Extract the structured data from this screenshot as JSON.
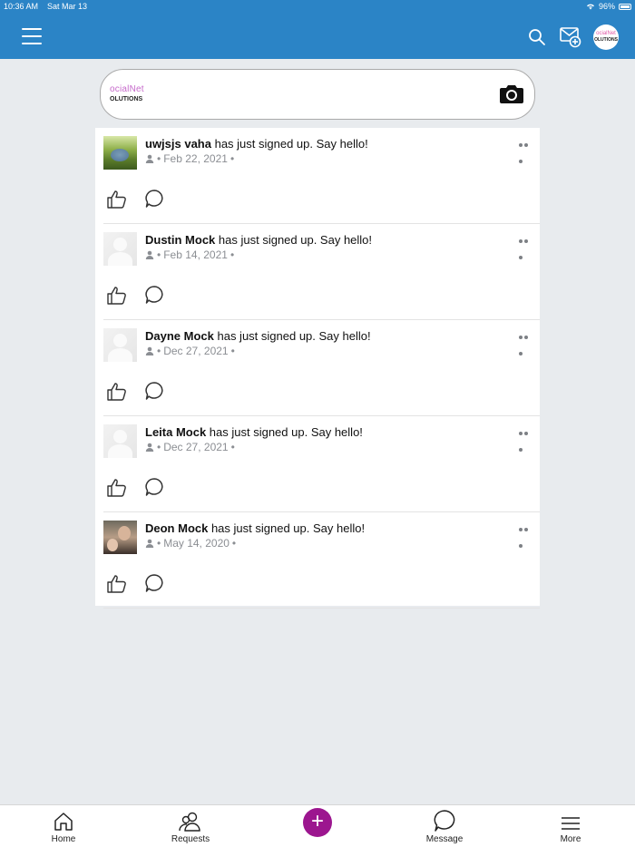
{
  "status_bar": {
    "time": "10:36 AM",
    "date": "Sat Mar 13",
    "battery": "96%"
  },
  "header": {
    "avatar_line1": "ocialNet",
    "avatar_line2": "OLUTIONS",
    "icons": [
      "menu-icon",
      "search-icon",
      "compose-mail-icon",
      "avatar"
    ]
  },
  "banner": {
    "logo_line1": "ocialNet",
    "logo_line2": "OLUTIONS",
    "icon": "camera-icon"
  },
  "posts": [
    {
      "name": "uwjsjs vaha",
      "action": " has just signed up. Say hello!",
      "date": "Feb 22, 2021",
      "avatar": "nature"
    },
    {
      "name": "Dustin Mock",
      "action": " has just signed up. Say hello!",
      "date": "Feb 14, 2021",
      "avatar": "blank"
    },
    {
      "name": "Dayne Mock",
      "action": " has just signed up. Say hello!",
      "date": "Dec 27, 2021",
      "avatar": "blank"
    },
    {
      "name": "Leita Mock",
      "action": " has just signed up. Say hello!",
      "date": "Dec 27, 2021",
      "avatar": "blank"
    },
    {
      "name": "Deon Mock",
      "action": " has just signed up. Say hello!",
      "date": "May 14, 2020",
      "avatar": "photo"
    }
  ],
  "tabbar": {
    "home": "Home",
    "requests": "Requests",
    "plus": "+",
    "message": "Message",
    "more": "More"
  },
  "colors": {
    "header": "#2b84c6",
    "page_bg": "#e8ebee",
    "plus_button": "#9c168f"
  }
}
